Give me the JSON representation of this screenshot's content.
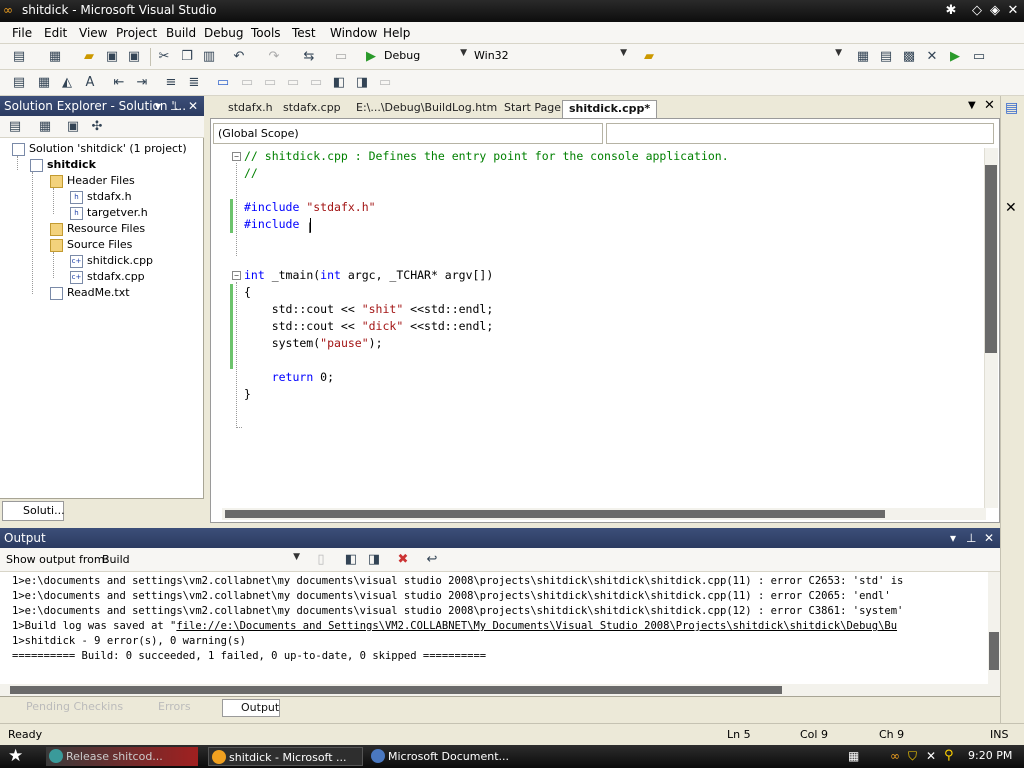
{
  "window": {
    "title": "shitdick - Microsoft Visual Studio"
  },
  "menu": [
    "File",
    "Edit",
    "View",
    "Project",
    "Build",
    "Debug",
    "Tools",
    "Test",
    "Window",
    "Help"
  ],
  "toolbar": {
    "config": "Debug",
    "platform": "Win32"
  },
  "solution_explorer": {
    "title": "Solution Explorer - Solution '...",
    "solution": "Solution 'shitdick' (1 project)",
    "project": "shitdick",
    "header_folder": "Header Files",
    "header_files": [
      "stdafx.h",
      "targetver.h"
    ],
    "resource_folder": "Resource Files",
    "source_folder": "Source Files",
    "source_files": [
      "shitdick.cpp",
      "stdafx.cpp"
    ],
    "readme": "ReadMe.txt",
    "tab_label": "Soluti..."
  },
  "doc_tabs": [
    "stdafx.h",
    "stdafx.cpp",
    "E:\\...\\Debug\\BuildLog.htm",
    "Start Page",
    "shitdick.cpp*"
  ],
  "editor": {
    "scope": "(Global Scope)",
    "lines": [
      {
        "segs": [
          {
            "t": "// shitdick.cpp : Defines the entry point for the console application.",
            "c": "cm"
          }
        ]
      },
      {
        "segs": [
          {
            "t": "//",
            "c": "cm"
          }
        ]
      },
      {
        "segs": []
      },
      {
        "segs": [
          {
            "t": "#include",
            "c": "kw"
          },
          {
            "t": " ",
            "c": ""
          },
          {
            "t": "\"stdafx.h\"",
            "c": "st"
          }
        ]
      },
      {
        "segs": [
          {
            "t": "#include",
            "c": "kw"
          }
        ]
      },
      {
        "segs": []
      },
      {
        "segs": []
      },
      {
        "segs": [
          {
            "t": "int",
            "c": "kw"
          },
          {
            "t": " _tmain(",
            "c": ""
          },
          {
            "t": "int",
            "c": "kw"
          },
          {
            "t": " argc, _TCHAR* argv[])",
            "c": ""
          }
        ]
      },
      {
        "segs": [
          {
            "t": "{",
            "c": ""
          }
        ]
      },
      {
        "segs": [
          {
            "t": "    std::cout << ",
            "c": ""
          },
          {
            "t": "\"shit\"",
            "c": "st"
          },
          {
            "t": " <<std::endl;",
            "c": ""
          }
        ]
      },
      {
        "segs": [
          {
            "t": "    std::cout << ",
            "c": ""
          },
          {
            "t": "\"dick\"",
            "c": "st"
          },
          {
            "t": " <<std::endl;",
            "c": ""
          }
        ]
      },
      {
        "segs": [
          {
            "t": "    system(",
            "c": ""
          },
          {
            "t": "\"pause\"",
            "c": "st"
          },
          {
            "t": ");",
            "c": ""
          }
        ]
      },
      {
        "segs": []
      },
      {
        "segs": [
          {
            "t": "    ",
            "c": ""
          },
          {
            "t": "return",
            "c": "kw"
          },
          {
            "t": " 0;",
            "c": ""
          }
        ]
      },
      {
        "segs": [
          {
            "t": "}",
            "c": ""
          }
        ]
      }
    ]
  },
  "output": {
    "title": "Output",
    "show_from_label": "Show output from:",
    "show_from_value": "Build",
    "lines": [
      "1>e:\\documents and settings\\vm2.collabnet\\my documents\\visual studio 2008\\projects\\shitdick\\shitdick\\shitdick.cpp(11) : error C2653: 'std' is",
      "1>e:\\documents and settings\\vm2.collabnet\\my documents\\visual studio 2008\\projects\\shitdick\\shitdick\\shitdick.cpp(11) : error C2065: 'endl'",
      "1>e:\\documents and settings\\vm2.collabnet\\my documents\\visual studio 2008\\projects\\shitdick\\shitdick\\shitdick.cpp(12) : error C3861: 'system'",
      "1>Build log was saved at \"",
      "1>shitdick - 9 error(s), 0 warning(s)",
      "========== Build: 0 succeeded, 1 failed, 0 up-to-date, 0 skipped =========="
    ],
    "build_log_link": "file://e:\\Documents and Settings\\VM2.COLLABNET\\My Documents\\Visual Studio 2008\\Projects\\shitdick\\shitdick\\Debug\\Bu"
  },
  "bottom_tabs": [
    "Pending Checkins",
    "Errors",
    "Output"
  ],
  "status": {
    "ready": "Ready",
    "ln": "Ln 5",
    "col": "Col 9",
    "ch": "Ch 9",
    "ins": "INS"
  },
  "taskbar": {
    "items": [
      "Release shitcod...",
      "shitdick - Microsoft ...",
      "Microsoft Document..."
    ],
    "clock": "9:20 PM"
  }
}
